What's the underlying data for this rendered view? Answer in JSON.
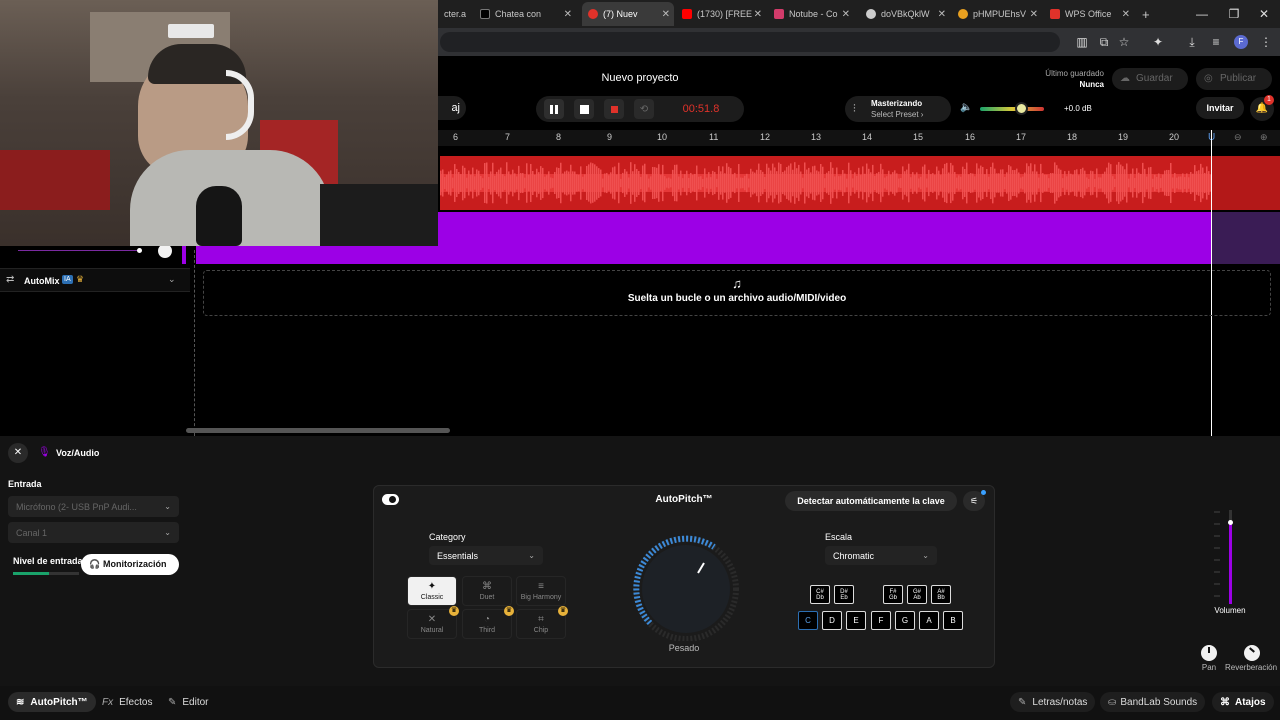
{
  "browser": {
    "tabs": [
      {
        "label": "cter.ai",
        "color": "#3a3a3a"
      },
      {
        "label": "Chatea con",
        "color": "#000000"
      },
      {
        "label": "(7) Nuev",
        "color": "#e0322a",
        "active": true
      },
      {
        "label": "(1730) [FREE",
        "color": "#ff0000"
      },
      {
        "label": "Notube - Co",
        "color": "#d23b6a"
      },
      {
        "label": "doVBkQklW",
        "color": "#cccccc"
      },
      {
        "label": "pHMPUEhsV",
        "color": "#e8a020"
      },
      {
        "label": "WPS Office",
        "color": "#e0322a"
      }
    ],
    "new_tab": "+",
    "profile_initial": "F"
  },
  "header": {
    "project_title": "Nuevo proyecto",
    "last_saved_label": "Último guardado",
    "last_saved_value": "Nunca",
    "save_label": "Guardar",
    "publish_label": "Publicar",
    "time": "00:51.8",
    "mastering_title": "Masterizando",
    "mastering_preset": "Select Preset",
    "volume_db": "+0.0 dB",
    "invite_label": "Invitar",
    "notification_count": "1",
    "left_partial": "aj"
  },
  "ruler": {
    "marks": [
      "6",
      "7",
      "8",
      "9",
      "10",
      "11",
      "12",
      "13",
      "14",
      "15",
      "16",
      "17",
      "18",
      "19",
      "20"
    ]
  },
  "tracks": {
    "automix_label": "AutoMix",
    "automix_badge": "IA",
    "dropzone_text": "Suelta un bucle o un archivo audio/MIDI/video"
  },
  "panel": {
    "title": "Voz/Audio",
    "input_label": "Entrada",
    "input_device": "Micrófono (2- USB PnP Audi...",
    "channel": "Canal 1",
    "input_level_label": "Nivel de entrada",
    "monitor_label": "Monitorización",
    "autopitch": {
      "title": "AutoPitch™",
      "detect_key_label": "Detectar automáticamente la clave",
      "category_label": "Category",
      "category_value": "Essentials",
      "styles": [
        {
          "label": "Classic",
          "icon": "sparkle-icon",
          "selected": true
        },
        {
          "label": "Duet",
          "icon": "duet-icon"
        },
        {
          "label": "Big Harmony",
          "icon": "harmony-icon"
        },
        {
          "label": "Natural",
          "icon": "natural-icon",
          "premium": true
        },
        {
          "label": "Third",
          "icon": "third-icon",
          "premium": true
        },
        {
          "label": "Chip",
          "icon": "chip-icon",
          "premium": true
        }
      ],
      "knob_label": "Pesado",
      "scale_label": "Escala",
      "scale_value": "Chromatic",
      "sharp_keys": [
        [
          "C#",
          "Db"
        ],
        [
          "D#",
          "Eb"
        ],
        [
          "F#",
          "Gb"
        ],
        [
          "G#",
          "Ab"
        ],
        [
          "A#",
          "Bb"
        ]
      ],
      "natural_keys": [
        "C",
        "D",
        "E",
        "F",
        "G",
        "A",
        "B"
      ],
      "selected_key": "C"
    },
    "volume_label": "Volumen",
    "volume_level": 0.87,
    "pan_label": "Pan",
    "reverb_label": "Reverberación"
  },
  "footer": {
    "autopitch": "AutoPitch™",
    "effects": "Efectos",
    "editor": "Editor",
    "lyrics": "Letras/notas",
    "sounds": "BandLab Sounds",
    "shortcuts": "Atajos"
  },
  "colors": {
    "audio_track": "#c81d1d",
    "purple_track": "#9c00e6",
    "accent_blue": "#2c6fb3",
    "record_red": "#e0322a"
  }
}
